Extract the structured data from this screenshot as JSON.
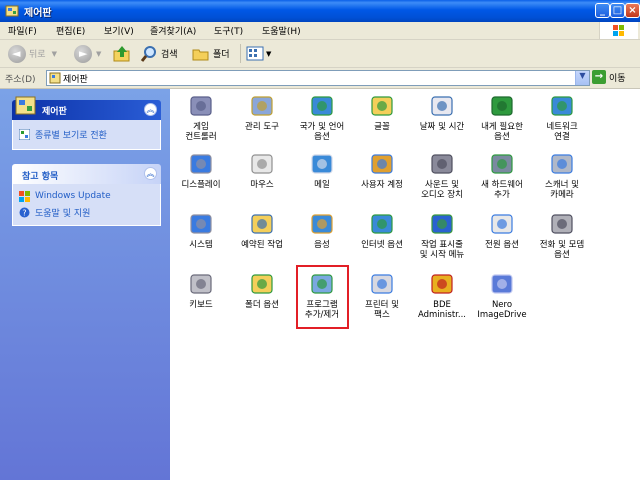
{
  "window": {
    "title": "제어판"
  },
  "menu": [
    "파일(F)",
    "편집(E)",
    "보기(V)",
    "즐겨찾기(A)",
    "도구(T)",
    "도움말(H)"
  ],
  "toolbar": {
    "back": "뒤로",
    "search": "검색",
    "folders": "폴더"
  },
  "address": {
    "label": "주소(D)",
    "value": "제어판",
    "go": "이동"
  },
  "left_panel": {
    "control_panel": {
      "title": "제어판",
      "task": "종류별 보기로 전환"
    },
    "see_also": {
      "title": "참고 항목",
      "items": [
        "Windows Update",
        "도움말 및 지원"
      ]
    }
  },
  "items": [
    {
      "label": "게임\n컨트롤러",
      "icon": "game-controller-icon"
    },
    {
      "label": "관리 도구",
      "icon": "admin-tools-icon"
    },
    {
      "label": "국가 및 언어\n옵션",
      "icon": "globe-icon"
    },
    {
      "label": "글꼴",
      "icon": "fonts-folder-icon"
    },
    {
      "label": "날짜 및 시간",
      "icon": "clock-icon"
    },
    {
      "label": "내게 필요한\n옵션",
      "icon": "accessibility-icon"
    },
    {
      "label": "네트워크\n연결",
      "icon": "network-icon"
    },
    {
      "label": "디스플레이",
      "icon": "display-icon"
    },
    {
      "label": "마우스",
      "icon": "mouse-icon"
    },
    {
      "label": "메일",
      "icon": "mail-icon"
    },
    {
      "label": "사용자 계정",
      "icon": "users-icon"
    },
    {
      "label": "사운드 및\n오디오 장치",
      "icon": "speaker-icon"
    },
    {
      "label": "새 하드웨어\n추가",
      "icon": "hardware-icon"
    },
    {
      "label": "스캐너 및\n카메라",
      "icon": "scanner-icon"
    },
    {
      "label": "시스템",
      "icon": "system-icon"
    },
    {
      "label": "예약된 작업",
      "icon": "scheduled-tasks-icon"
    },
    {
      "label": "음성",
      "icon": "speech-icon"
    },
    {
      "label": "인터넷 옵션",
      "icon": "internet-options-icon"
    },
    {
      "label": "작업 표시줄\n및 시작 메뉴",
      "icon": "taskbar-icon"
    },
    {
      "label": "전원 옵션",
      "icon": "power-icon"
    },
    {
      "label": "전화 및 모뎀\n옵션",
      "icon": "phone-modem-icon"
    },
    {
      "label": "키보드",
      "icon": "keyboard-icon"
    },
    {
      "label": "폴더 옵션",
      "icon": "folder-options-icon"
    },
    {
      "label": "프로그램\n추가/제거",
      "icon": "add-remove-programs-icon"
    },
    {
      "label": "프린터 및\n팩스",
      "icon": "printer-icon"
    },
    {
      "label": "BDE\nAdministr...",
      "icon": "bde-admin-icon"
    },
    {
      "label": "Nero\nImageDrive",
      "icon": "nero-imagedrive-icon"
    }
  ]
}
